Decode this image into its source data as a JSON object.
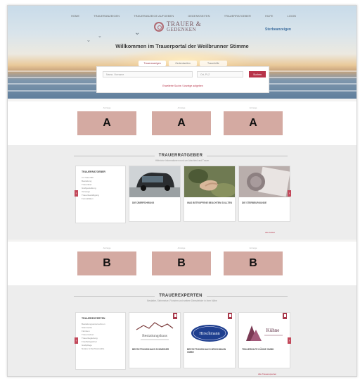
{
  "nav": {
    "items": [
      "Home",
      "Traueranzeigen",
      "Traueranzeige aufgeben",
      "Gedenkseiten",
      "Trauerratgeber",
      "Hilfe",
      "Login"
    ]
  },
  "brand": {
    "line1": "TRAUER &",
    "line2": "GEDENKEN"
  },
  "partner": {
    "name": "Sterbeanzeigen"
  },
  "hero": {
    "headline": "Willkommen im Trauerportal der Weilbrunner Stimme"
  },
  "search": {
    "tabs": [
      "Traueranzeigen",
      "Gedenkseiten",
      "Trauerhilfe"
    ],
    "name_placeholder": "Name, Vorname",
    "place_placeholder": "Ort, PLZ",
    "button_label": "Suchen",
    "advanced_link": "Erweiterte Suche / Anzeige aufgeben"
  },
  "ads_top": {
    "label": "Anzeige",
    "boxes": [
      "A",
      "A",
      "A"
    ]
  },
  "ads_bottom": {
    "label": "Anzeige",
    "boxes": [
      "B",
      "B",
      "B"
    ]
  },
  "ratgeber": {
    "title": "TRAUERRATGEBER",
    "subtitle": "Hilfreiche Informationen rund um Abschied und Trauer",
    "panel_title": "Trauerratgeber",
    "panel_items": [
      "Im Trauerfall",
      "Bestattung",
      "Trauerfeier",
      "Grabgestaltung",
      "Vorsorge",
      "Trauerbewältigung",
      "Formalitäten"
    ],
    "cards": [
      {
        "caption": "Die Überführung"
      },
      {
        "caption": "Was Betroffene beachten sollten"
      },
      {
        "caption": "Die Sterbeurkunde"
      }
    ],
    "more_link": "Alle Artikel"
  },
  "experten": {
    "title": "TRAUEREXPERTEN",
    "subtitle": "Bestatter, Steinmetze, Floristen und weitere Dienstleister in Ihrer Nähe",
    "panel_title": "Trauerexperten",
    "panel_items": [
      "Bestattungsunternehmen",
      "Steinmetze",
      "Floristen",
      "Trauerredner",
      "Trauerbegleitung",
      "Friedhofsgärtner",
      "Grabpflege",
      "Notare & Rechtsanwälte"
    ],
    "cards": [
      {
        "caption": "Bestattungshaus Schneider",
        "logo_word": "Bestattungshaus"
      },
      {
        "caption": "Bestattungshaus Hirschmann GmbH",
        "logo_word": "Hirschmann"
      },
      {
        "caption": "Trauerhilfe Kühne GmbH",
        "logo_word": "Kühne"
      }
    ],
    "more_link": "Alle Trauerexperten"
  },
  "colors": {
    "accent": "#b8344a",
    "ad_box": "#d4aaa2",
    "section_bg": "#ededed"
  }
}
